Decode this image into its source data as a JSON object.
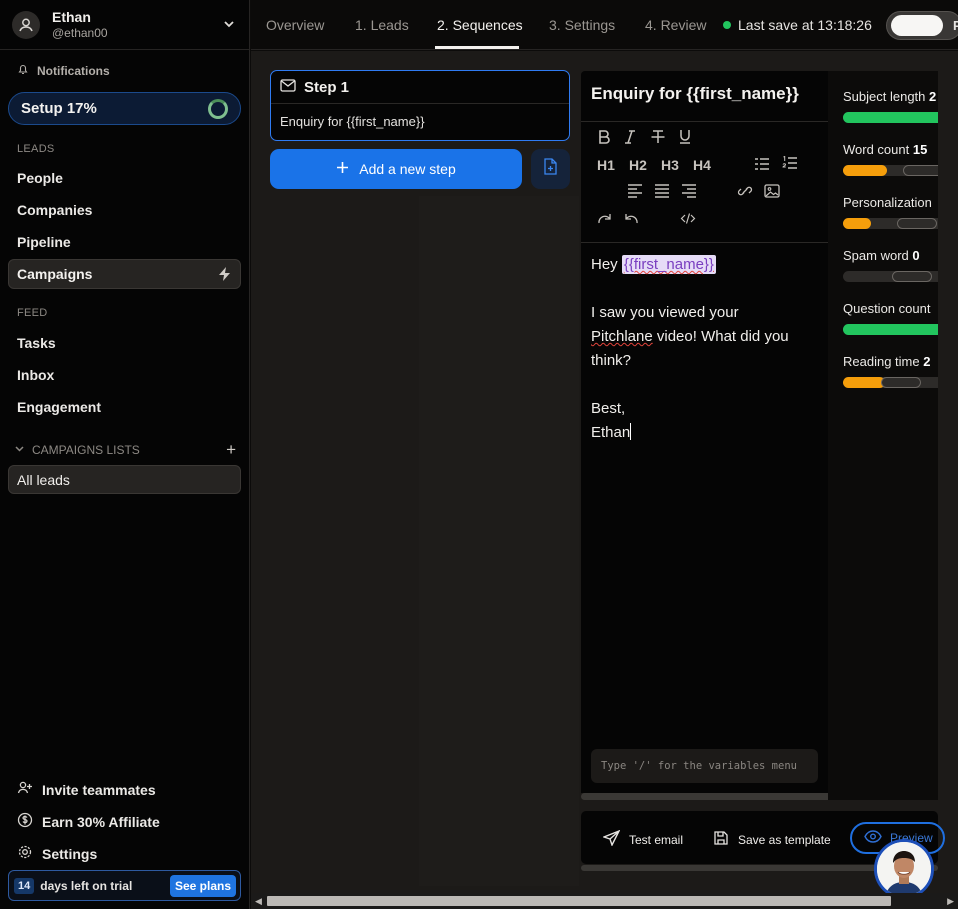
{
  "user": {
    "name": "Ethan",
    "handle": "@ethan00"
  },
  "sidebar": {
    "notifications": "Notifications",
    "setup": {
      "label": "Setup 17%",
      "progress": 0.17
    },
    "leads_label": "LEADS",
    "leads_items": [
      "People",
      "Companies",
      "Pipeline",
      "Campaigns"
    ],
    "feed_label": "FEED",
    "feed_items": [
      "Tasks",
      "Inbox",
      "Engagement"
    ],
    "lists_label": "CAMPAIGNS LISTS",
    "lists_add": "+",
    "lists_items": [
      "All leads"
    ],
    "bottom": [
      "Invite teammates",
      "Earn 30% Affiliate",
      "Settings"
    ],
    "trial": {
      "days": "14",
      "text": "days left on trial",
      "button": "See plans"
    }
  },
  "topbar": {
    "tabs": [
      "Overview",
      "1. Leads",
      "2. Sequences",
      "3. Settings",
      "4. Review"
    ],
    "active_tab": "2. Sequences",
    "save_status": "Last save at 13:18:26",
    "toggle_char": "P"
  },
  "steps": {
    "step_title": "Step 1",
    "step_subject": "Enquiry for {{first_name}}",
    "add_step": "Add a new step"
  },
  "editor": {
    "subject": "Enquiry for {{first_name}}",
    "toolbar": {
      "h1": "H1",
      "h2": "H2",
      "h3": "H3",
      "h4": "H4"
    },
    "body": {
      "greeting": "Hey",
      "variable": "{{first_name}}",
      "line1a": "I saw you viewed your",
      "line1b_err": "Pitchlane",
      "line1b": " video! What did you",
      "line1c": "think?",
      "sign1": "Best,",
      "sign2": "Ethan"
    },
    "var_placeholder": "Type '/' for the variables menu"
  },
  "metrics": [
    {
      "label": "Subject length",
      "value": "2",
      "color": "#22c55e",
      "fill": 1.0
    },
    {
      "label": "Word count",
      "value": "15",
      "color": "#f59e0b",
      "fill": 0.37
    },
    {
      "label": "Personalization",
      "value": "",
      "color": "#f59e0b",
      "fill": 0.23
    },
    {
      "label": "Spam word",
      "value": "0",
      "color": "#2d2b29",
      "fill": 0.0
    },
    {
      "label": "Question count",
      "value": "",
      "color": "#22c55e",
      "fill": 1.0
    },
    {
      "label": "Reading time",
      "value": "2",
      "color": "#f59e0b",
      "fill": 0.35
    }
  ],
  "actions": {
    "test_email": "Test email",
    "save_template": "Save as template",
    "preview": "Preview"
  },
  "colors": {
    "accent": "#1a73e8",
    "success": "#22c55e",
    "warning": "#f59e0b",
    "variable_bg": "#e6dcf7",
    "variable_text": "#7a3fc0"
  }
}
